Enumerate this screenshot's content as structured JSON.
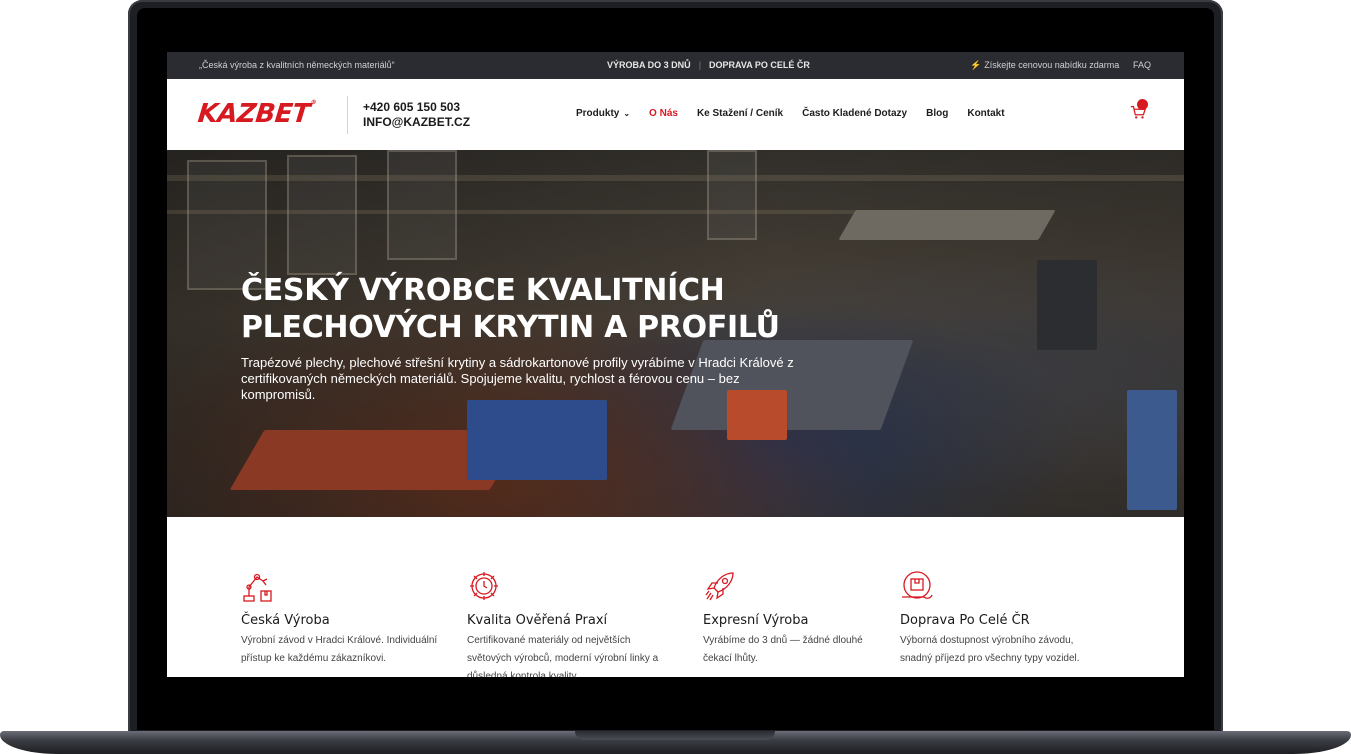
{
  "topbar": {
    "quote": "„Česká výroba z kvalitních německých materiálů“",
    "production": "VÝROBA DO 3 DNŮ",
    "separator": "|",
    "shipping": "DOPRAVA PO CELÉ ČR",
    "offer_icon": "lightning-icon",
    "offer": "Získejte cenovou nabídku zdarma",
    "faq": "FAQ"
  },
  "header": {
    "logo": "KAZBET",
    "logo_mark": "®",
    "phone": "+420 605 150 503",
    "email": "INFO@KAZBET.CZ",
    "nav": [
      {
        "label": "Produkty"
      },
      {
        "label": "O Nás"
      },
      {
        "label": "Ke Stažení / Ceník"
      },
      {
        "label": "Často Kladené Dotazy"
      },
      {
        "label": "Blog"
      },
      {
        "label": "Kontakt"
      }
    ],
    "active_nav": "O Nás",
    "cart_icon": "cart-icon"
  },
  "hero": {
    "title_line1": "ČESKÝ VÝROBCE KVALITNÍCH",
    "title_line2": "PLECHOVÝCH KRYTIN A PROFILŮ",
    "subtitle": "Trapézové plechy, plechové střešní krytiny a sádrokartonové profily vyrábíme v Hradci Králové z certifikovaných německých materiálů. Spojujeme kvalitu, rychlost a férovou cenu – bez kompromisů."
  },
  "features": [
    {
      "icon": "robot-arm-icon",
      "title": "Česká Výroba",
      "text": "Výrobní závod v Hradci Králové. Individuální přístup ke každému zákazníkovi."
    },
    {
      "icon": "gear-clock-icon",
      "title": "Kvalita Ověřená Praxí",
      "text": "Certifikované materiály od největších světových výrobců, moderní výrobní linky a důsledná kontrola kvality."
    },
    {
      "icon": "rocket-icon",
      "title": "Expresní Výroba",
      "text": "Vyrábíme do 3 dnů — žádné dlouhé čekací lhůty."
    },
    {
      "icon": "delivery-package-icon",
      "title": "Doprava Po Celé ČR",
      "text": "Výborná dostupnost výrobního závodu, snadný příjezd pro všechny typy vozidel."
    }
  ],
  "colors": {
    "brand_red": "#d71920",
    "topbar_bg": "#2b2c31",
    "text_dark": "#1a1a1a"
  }
}
